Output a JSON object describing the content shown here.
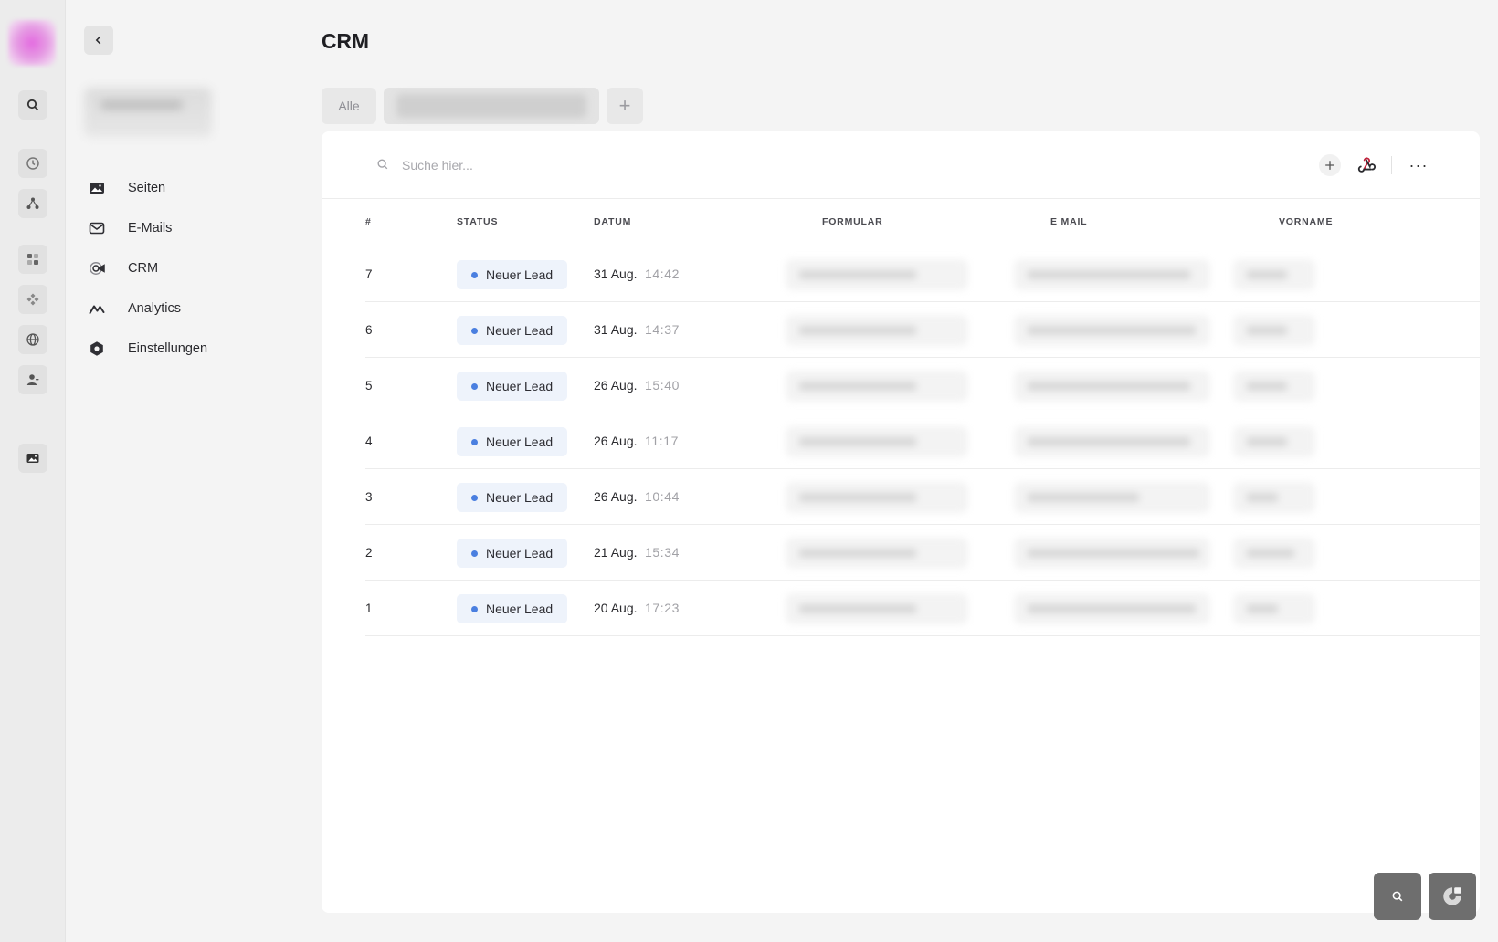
{
  "page": {
    "title": "CRM"
  },
  "rail": {
    "icons": [
      "search-icon",
      "history-icon",
      "share-nodes-icon",
      "dashboard-icon",
      "components-icon",
      "globe-icon",
      "user-icon",
      "image-icon"
    ]
  },
  "sidebar": {
    "items": [
      {
        "label": "Seiten",
        "icon": "image-icon"
      },
      {
        "label": "E-Mails",
        "icon": "mail-icon"
      },
      {
        "label": "CRM",
        "icon": "crm-icon"
      },
      {
        "label": "Analytics",
        "icon": "chart-line-icon"
      },
      {
        "label": "Einstellungen",
        "icon": "settings-icon"
      }
    ]
  },
  "tabs": {
    "all_label": "Alle",
    "add_label": "+"
  },
  "search": {
    "placeholder": "Suche hier..."
  },
  "toolbar": {
    "more_label": "···"
  },
  "table": {
    "columns": [
      "#",
      "STATUS",
      "DATUM",
      "FORMULAR",
      "E MAIL",
      "VORNAME"
    ],
    "rows": [
      {
        "num": "7",
        "status": "Neuer Lead",
        "date": "31 Aug.",
        "time": "14:42"
      },
      {
        "num": "6",
        "status": "Neuer Lead",
        "date": "31 Aug.",
        "time": "14:37"
      },
      {
        "num": "5",
        "status": "Neuer Lead",
        "date": "26 Aug.",
        "time": "15:40"
      },
      {
        "num": "4",
        "status": "Neuer Lead",
        "date": "26 Aug.",
        "time": "11:17"
      },
      {
        "num": "3",
        "status": "Neuer Lead",
        "date": "26 Aug.",
        "time": "10:44"
      },
      {
        "num": "2",
        "status": "Neuer Lead",
        "date": "21 Aug.",
        "time": "15:34"
      },
      {
        "num": "1",
        "status": "Neuer Lead",
        "date": "20 Aug.",
        "time": "17:23"
      }
    ]
  },
  "colors": {
    "status_dot": "#4a7fe0",
    "badge_bg": "#eef3fb",
    "webhook_accent": "#c0223b"
  }
}
